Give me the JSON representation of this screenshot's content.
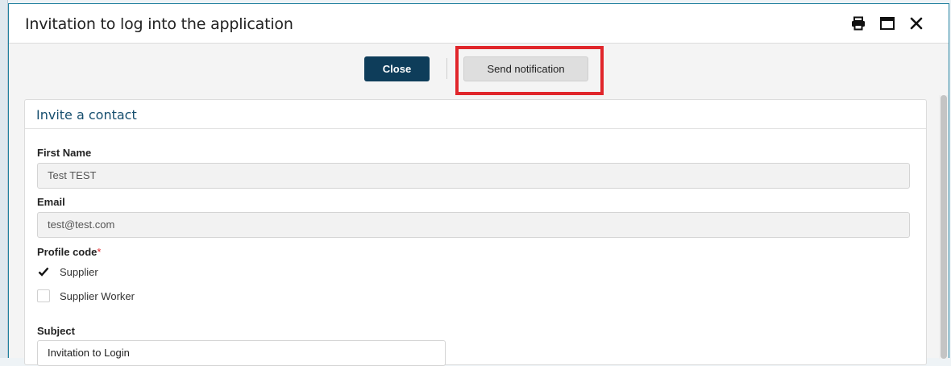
{
  "dialog": {
    "title": "Invitation to log into the application",
    "icons": [
      "printer-icon",
      "maximize-icon",
      "close-icon"
    ]
  },
  "actions": {
    "close_label": "Close",
    "send_label": "Send notification"
  },
  "form": {
    "section_title": "Invite a contact",
    "first_name_label": "First Name",
    "first_name_value": "Test TEST",
    "email_label": "Email",
    "email_value": "test@test.com",
    "profile_code_label": "Profile code",
    "required_marker": "*",
    "profile_options": [
      {
        "label": "Supplier",
        "checked": true
      },
      {
        "label": "Supplier Worker",
        "checked": false
      }
    ],
    "subject_label": "Subject",
    "subject_value": "Invitation to Login"
  },
  "colors": {
    "primary_button": "#0e3d5a",
    "highlight": "#e0262b",
    "section_title": "#174f6f"
  }
}
